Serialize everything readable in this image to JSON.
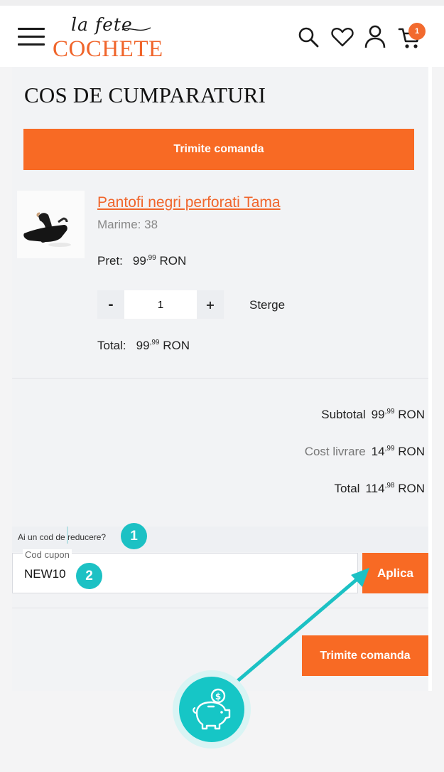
{
  "header": {
    "logo_script": "la fete",
    "logo_main": "COCHETE",
    "cart_count": "1",
    "icons": [
      "menu-icon",
      "search-icon",
      "heart-icon",
      "user-icon",
      "cart-icon"
    ]
  },
  "page": {
    "title": "COS DE CUMPARATURI",
    "submit_top": "Trimite comanda",
    "submit_bottom": "Trimite comanda"
  },
  "product": {
    "name": "Pantofi negri perforati Tama",
    "size": "Marime: 38",
    "price_label": "Pret:",
    "price_int": "99",
    "price_dec": ",99",
    "currency": "RON",
    "quantity": "1",
    "minus": "-",
    "plus": "+",
    "delete": "Sterge",
    "total_label": "Total:",
    "total_int": "99",
    "total_dec": ",99"
  },
  "summary": {
    "subtotal_label": "Subtotal",
    "subtotal_int": "99",
    "subtotal_dec": ",99",
    "shipping_label": "Cost livrare",
    "shipping_int": "14",
    "shipping_dec": ",99",
    "total_label": "Total",
    "total_int": "114",
    "total_dec": ",98",
    "currency": "RON"
  },
  "coupon": {
    "question": "Ai un cod de reducere?",
    "field_label": "Cod cupon",
    "value": "NEW10",
    "apply": "Aplica"
  },
  "annotations": {
    "step1": "1",
    "step2": "2"
  },
  "colors": {
    "brand_orange": "#f86a24",
    "teal": "#1cc1c4"
  }
}
